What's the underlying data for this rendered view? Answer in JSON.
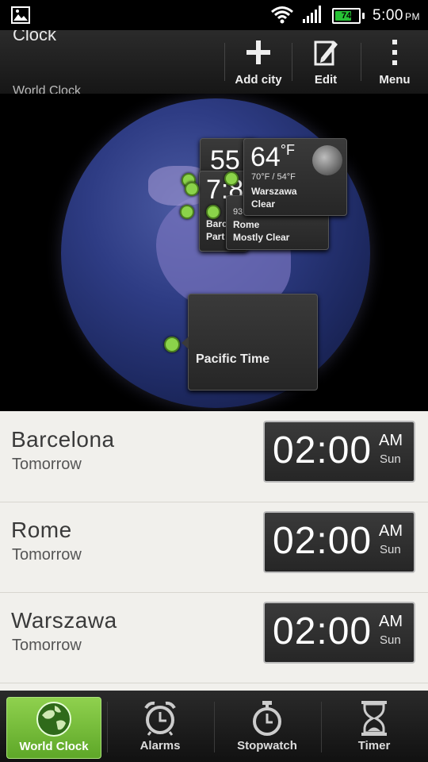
{
  "status_bar": {
    "time": "5:00",
    "ampm": "PM",
    "battery": "74",
    "icons": [
      "image-icon",
      "wifi-icon",
      "signal-icon",
      "battery-icon"
    ]
  },
  "action_bar": {
    "title": "Clock",
    "subtitle": "World Clock",
    "add_city": "Add city",
    "edit": "Edit",
    "menu": "Menu"
  },
  "globe": {
    "cards": {
      "back1_temp": "55",
      "back2_temp": "7:8",
      "back2_city": "Barc",
      "back2_cond": "Part",
      "rome_hum": "93",
      "rome_city": "Rome",
      "rome_cond": "Mostly Clear",
      "warszawa_temp": "64",
      "warszawa_unit": "°F",
      "warszawa_range": "70°F / 54°F",
      "warszawa_city": "Warszawa",
      "warszawa_cond": "Clear",
      "pacific_label": "Pacific Time"
    }
  },
  "cities": [
    {
      "name": "Barcelona",
      "day": "Tomorrow",
      "time": "02:00",
      "ampm": "AM",
      "weekday": "Sun"
    },
    {
      "name": "Rome",
      "day": "Tomorrow",
      "time": "02:00",
      "ampm": "AM",
      "weekday": "Sun"
    },
    {
      "name": "Warszawa",
      "day": "Tomorrow",
      "time": "02:00",
      "ampm": "AM",
      "weekday": "Sun"
    }
  ],
  "tabs": [
    {
      "label": "World Clock",
      "icon": "globe-icon",
      "active": true
    },
    {
      "label": "Alarms",
      "icon": "alarm-clock-icon",
      "active": false
    },
    {
      "label": "Stopwatch",
      "icon": "stopwatch-icon",
      "active": false
    },
    {
      "label": "Timer",
      "icon": "hourglass-icon",
      "active": false
    }
  ],
  "colors": {
    "accent": "#7cc241",
    "dot": "#8bd34a",
    "list_bg": "#f1f0ec"
  }
}
